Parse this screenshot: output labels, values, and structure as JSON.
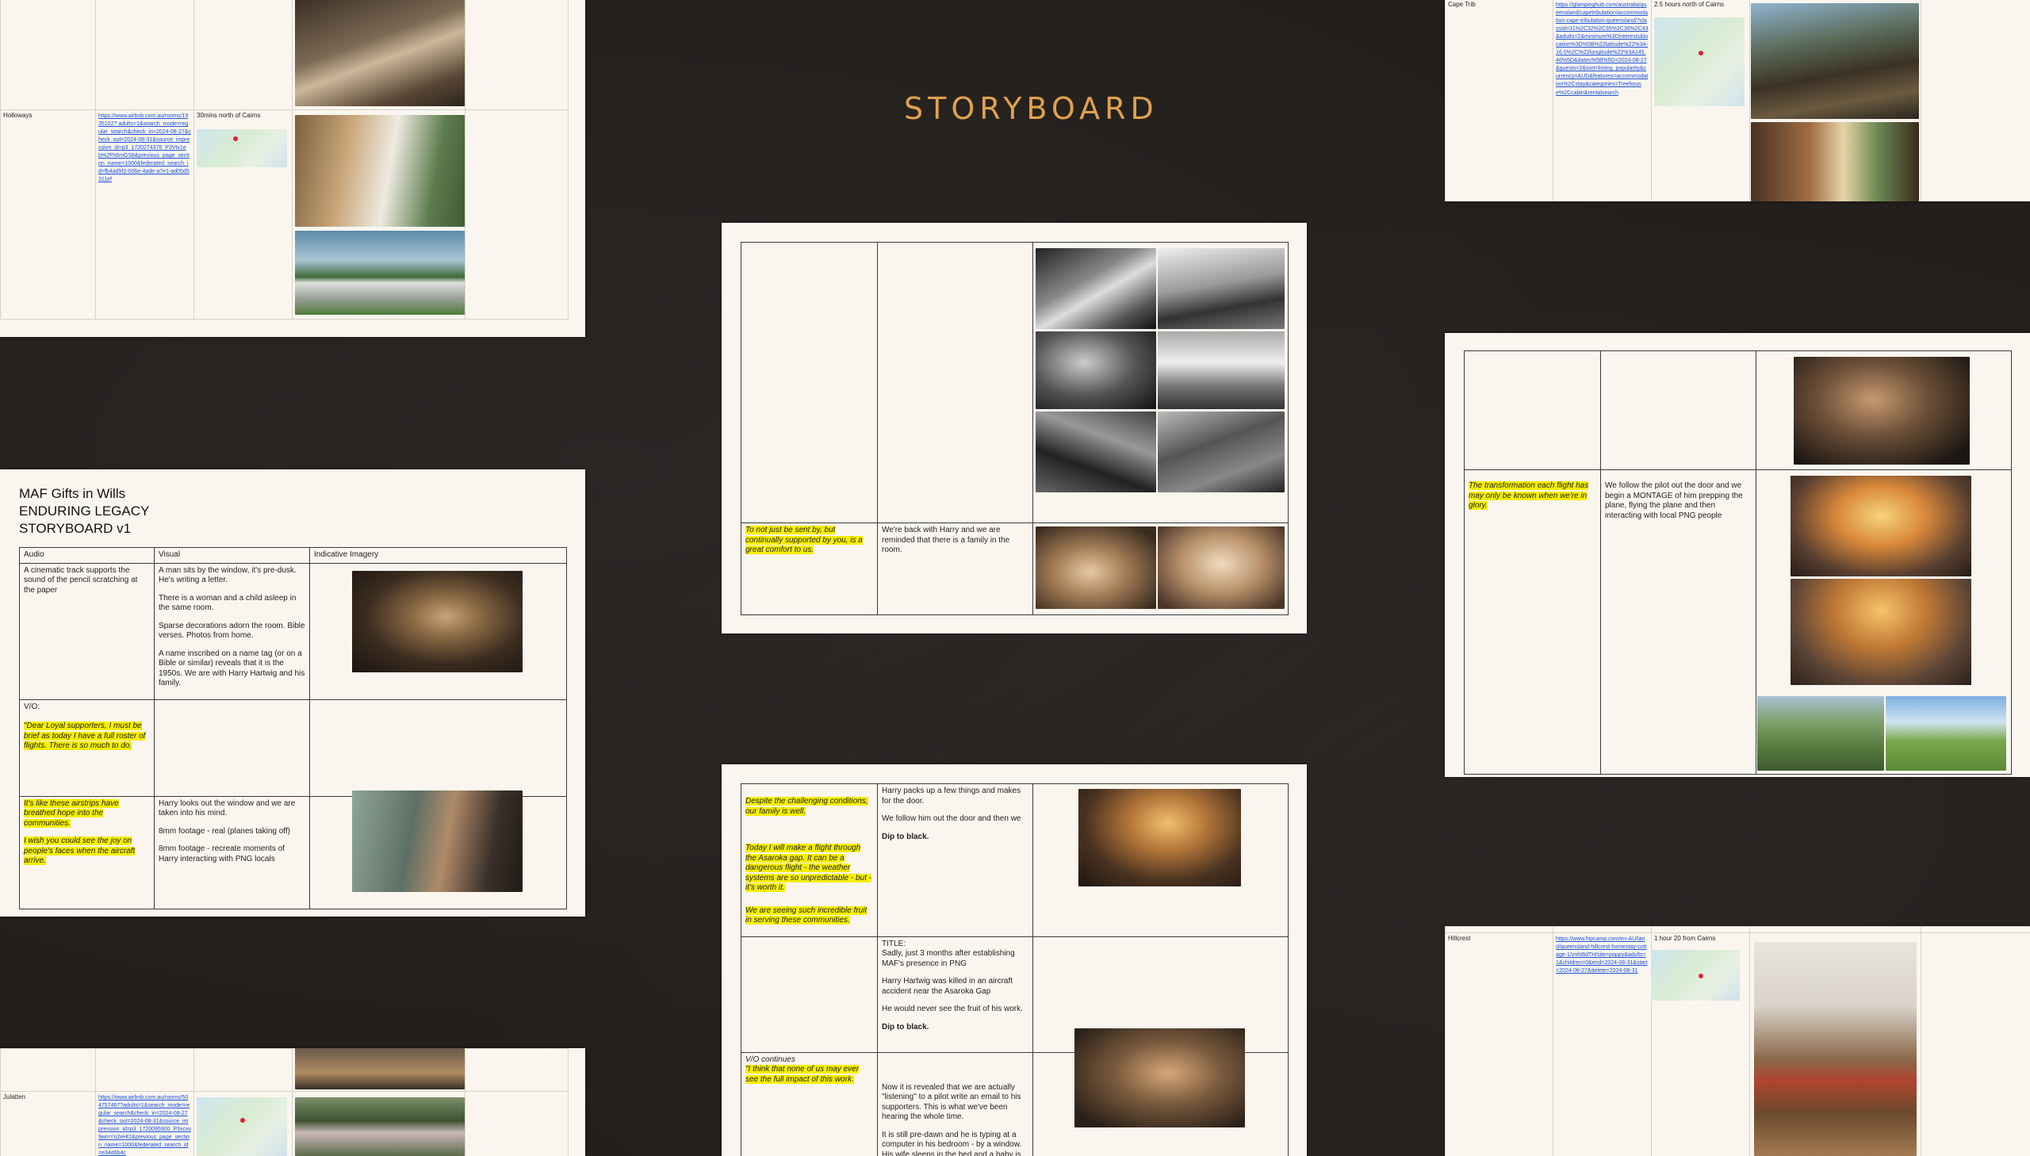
{
  "heading": "STORYBOARD",
  "left_top": {
    "row": {
      "name": "Holloways",
      "link": "https://www.airbnb.com.au/rooms/1935102? adults=1&search_mode=regular_search&check_in=2024-08-27&check_out=2024-08-31&source_impression_id=p3_1720274376_P3Vtv1eb%2Fh6mGS8&previous_page_section_name=1000&federated_search_id=fb4ad5f2-006e-4ade-a7e1-ad05d5311ef",
      "note": "30mins north of Cairns"
    }
  },
  "left_main": {
    "title_lines": [
      "MAF Gifts in Wills",
      "ENDURING LEGACY",
      "STORYBOARD v1"
    ],
    "headers": [
      "Audio",
      "Visual",
      "Indicative Imagery"
    ],
    "row1": {
      "audio": "A cinematic track supports the sound of the pencil scratching at the paper",
      "visual": [
        "A man sits by the window, it's pre-dusk. He's writing a letter.",
        "There is a woman and a child asleep in the same room.",
        "Sparse decorations adorn the room. Bible verses. Photos from home.",
        "A name inscribed on a name tag (or on a Bible or similar) reveals that it is the 1950s. We are with Harry Hartwig and his family."
      ]
    },
    "row2": {
      "label": "V/O:",
      "quote": "\"Dear Loyal supporters, I must be brief as today I have a full roster of flights. There is so much to do."
    },
    "row3": {
      "audio": [
        "It's like these airstrips have breathed hope into the communities.",
        "I wish you could see the joy on people's faces when the aircraft arrive."
      ],
      "visual": [
        "Harry looks out the window and we are taken into his mind.",
        "8mm footage - real (planes taking off)",
        "8mm footage - recreate moments of Harry interacting with PNG locals"
      ]
    }
  },
  "left_bottom": {
    "name": "Julatten",
    "link": "https://www.airbnb.com.au/rooms/504757467?adults=1&search_mode=regular_search&check_in=2024-08-27&check_out=2024-08-31&source_impression_id=p3_1720095900_P3xcvv9wmYn2eHt1&previous_page_section_name=1000&federated_search_id=e34d6b4c"
  },
  "center_top": {
    "audio": "To not just be sent by, but continually supported by you, is a great comfort to us.",
    "visual": "We're back with Harry and we are reminded that there is a family in the room."
  },
  "center_bottom": {
    "row1": {
      "audio": [
        "Despite the challenging conditions, our family is well.",
        "Today I will make a flight through the Asaroka gap. It can be a dangerous flight - the weather systems are so unpredictable - but - it's worth it.",
        "We are seeing such incredible fruit in serving these communities."
      ],
      "visual": [
        "Harry packs up a few things and makes for the door.",
        "We follow him out the door and then we",
        "Dip to black."
      ]
    },
    "row2": {
      "label": "TITLE:",
      "visual": [
        "Sadly, just 3 months after establishing MAF's presence in PNG",
        "Harry Hartwig was killed in an aircraft accident near the Asaroka Gap",
        "He would never see the fruit of his work.",
        "Dip to black."
      ]
    },
    "row3": {
      "label": "V/O continues",
      "quote": "\"I think that none of us may ever see the full impact of this work.",
      "visual": [
        "Now it is revealed that we are actually \"listening\" to a pilot write an email to his supporters. This is what we've been hearing the whole time.",
        "It is still pre-dawn and he is typing at a computer in his bedroom - by a window. His wife sleeps in the bed and a baby is in a crib next to them."
      ]
    }
  },
  "right_top": {
    "name": "Cape Trib",
    "link": "https://glampinghub.com/australia/queensland/capetribulation/accommodation-cape-tribulation-queensland/?classId=31%2C32%2C35%2C36%2C43&adults=2&minimum%3Dinterests&location%3D%5B%22latitude%22%3A-16.0%2C%22longitude%22%3A145.46%5D&dates%5B%5D=2024-08-27&guests=2&sort=listing_popularity&currency=AUD&features=accommodation%2Cstay&categories=Treehouse%2Ccabin&rentalsearch",
    "note": "2.5 hours north of  Cairns"
  },
  "right_mid": {
    "audio": "The transformation each flight has may only be known when we're in glory.",
    "visual": "We follow the pilot out the door and we begin a MONTAGE of him prepping the plane, flying the plane and then interacting with local PNG people"
  },
  "right_bottom": {
    "name": "Hillcrest",
    "link": "https://www.hipcamp.com/en-AU/land/queensland-hillcrest-homestay-cottage-1/vnhI8dTH/site=poppy&adults=1&children=0&end=2024-08-31&start=2024-08-27&delete=2024-08-31",
    "note": "1 hour 20 from Cairns"
  }
}
